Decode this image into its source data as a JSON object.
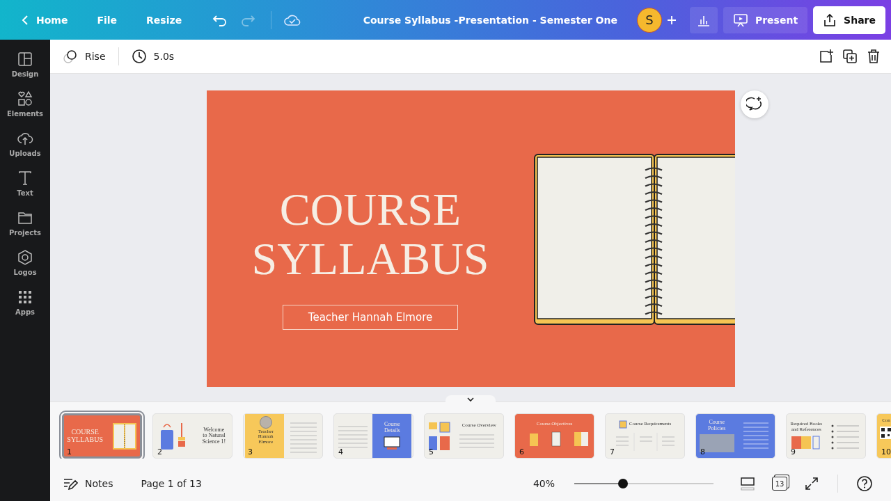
{
  "topbar": {
    "back": "Home",
    "menus": [
      "File",
      "Resize"
    ],
    "history": [
      {
        "kind": "undo",
        "disabled": false
      },
      {
        "kind": "redo",
        "disabled": true
      }
    ],
    "title": "Course Syllabus -Presentation - Semester One",
    "avatar": "S",
    "present": "Present",
    "share": "Share"
  },
  "sidebar": [
    {
      "kind": "design",
      "label": "Design"
    },
    {
      "kind": "elements",
      "label": "Elements"
    },
    {
      "kind": "uploads",
      "label": "Uploads"
    },
    {
      "kind": "text",
      "label": "Text"
    },
    {
      "kind": "projects",
      "label": "Projects"
    },
    {
      "kind": "logos",
      "label": "Logos"
    },
    {
      "kind": "apps",
      "label": "Apps"
    }
  ],
  "toolbar": {
    "animation": "Rise",
    "duration": "5.0s"
  },
  "slide": {
    "title_lines": [
      "COURSE",
      "SYLLABUS"
    ],
    "subtitle": "Teacher Hannah Elmore"
  },
  "thumbnails": [
    {
      "number": "1",
      "kind": "cover",
      "selected": true,
      "lines": [
        "COURSE",
        "SYLLABUS"
      ]
    },
    {
      "number": "2",
      "kind": "welcome",
      "selected": false,
      "lines": [
        "Welcome",
        "to Natural",
        "Science 1!"
      ]
    },
    {
      "number": "3",
      "kind": "teacher",
      "selected": false,
      "lines": [
        "Teacher",
        "Hannah",
        "Elmore"
      ]
    },
    {
      "number": "4",
      "kind": "details",
      "selected": false,
      "lines": [
        "Course",
        "Details"
      ]
    },
    {
      "number": "5",
      "kind": "overview",
      "selected": false,
      "lines": [
        "Course Overview"
      ]
    },
    {
      "number": "6",
      "kind": "objectives",
      "selected": false,
      "lines": [
        "Course Objectives"
      ]
    },
    {
      "number": "7",
      "kind": "requirements",
      "selected": false,
      "lines": [
        "Course Requirements"
      ]
    },
    {
      "number": "8",
      "kind": "policies",
      "selected": false,
      "lines": [
        "Course",
        "Policies"
      ]
    },
    {
      "number": "9",
      "kind": "books",
      "selected": false,
      "lines": [
        "Required Books",
        "and References"
      ]
    },
    {
      "number": "10",
      "kind": "partial",
      "selected": false,
      "lines": [
        "Con"
      ]
    }
  ],
  "footer": {
    "notes": "Notes",
    "page": "Page 1 of 13",
    "zoom": "40%",
    "level": 0.35,
    "page_count": "13"
  }
}
